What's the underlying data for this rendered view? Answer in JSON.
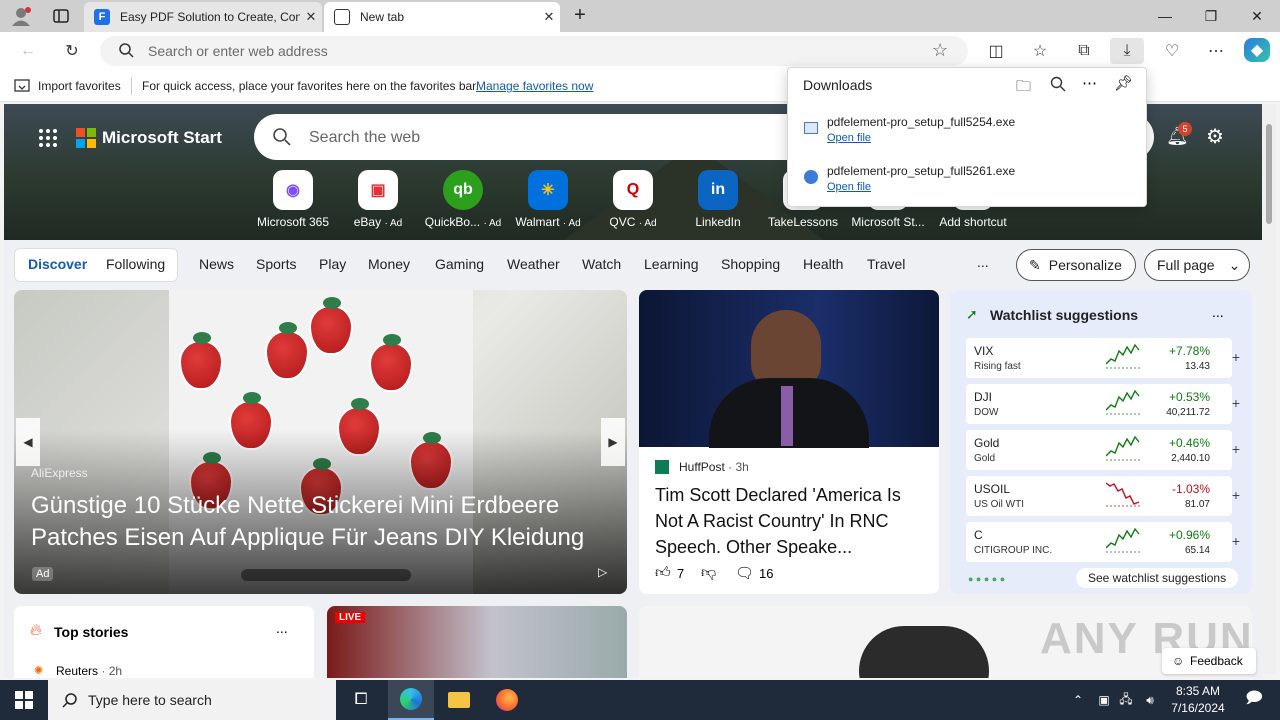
{
  "browser": {
    "tabs": [
      {
        "title": "Easy PDF Solution to Create, Con",
        "icon": "pdfelement-icon"
      },
      {
        "title": "New tab",
        "icon": "newtab-icon"
      }
    ],
    "address": {
      "placeholder": "Search or enter web address"
    },
    "window_controls": [
      "minimize",
      "restore",
      "close"
    ]
  },
  "favorites_bar": {
    "import_label": "Import favorites",
    "message": "For quick access, place your favorites here on the favorites bar.",
    "manage_link": "Manage favorites now"
  },
  "downloads": {
    "title": "Downloads",
    "items": [
      {
        "filename": "pdfelement-pro_setup_full5254.exe",
        "action": "Open file"
      },
      {
        "filename": "pdfelement-pro_setup_full5261.exe",
        "action": "Open file"
      }
    ]
  },
  "start": {
    "brand": "Microsoft Start",
    "search_placeholder": "Search the web",
    "notification_count": "5",
    "shortcuts": [
      {
        "label": "Microsoft 365",
        "ad": ""
      },
      {
        "label": "eBay",
        "ad": "· Ad"
      },
      {
        "label": "QuickBo...",
        "ad": "· Ad"
      },
      {
        "label": "Walmart",
        "ad": "· Ad"
      },
      {
        "label": "QVC",
        "ad": "· Ad"
      },
      {
        "label": "LinkedIn",
        "ad": ""
      },
      {
        "label": "TakeLessons",
        "ad": ""
      },
      {
        "label": "Microsoft St...",
        "ad": ""
      },
      {
        "label": "Add shortcut",
        "ad": ""
      }
    ],
    "nav": {
      "discover": "Discover",
      "following": "Following",
      "items": [
        "News",
        "Sports",
        "Play",
        "Money",
        "Gaming",
        "Weather",
        "Watch",
        "Learning",
        "Shopping",
        "Health",
        "Travel"
      ],
      "more": "...",
      "personalize": "Personalize",
      "layout": "Full page"
    }
  },
  "hero_card": {
    "source": "AliExpress",
    "headline": "Günstige 10 Stücke Nette Stickerei Mini Erdbeere Patches Eisen Auf Applique Für Jeans DIY Kleidung",
    "ad_badge": "Ad"
  },
  "news_card": {
    "source": "HuffPost",
    "age": "· 3h",
    "headline": "Tim Scott Declared 'America Is Not A Racist Country' In RNC Speech. Other Speake...",
    "likes": "7",
    "comments": "16"
  },
  "watchlist": {
    "title": "Watchlist suggestions",
    "more": "...",
    "rows": [
      {
        "symbol": "VIX",
        "sub": "Rising fast",
        "change": "+7.78%",
        "price": "13.43",
        "direction": "up"
      },
      {
        "symbol": "DJI",
        "sub": "DOW",
        "change": "+0.53%",
        "price": "40,211.72",
        "direction": "up"
      },
      {
        "symbol": "Gold",
        "sub": "Gold",
        "change": "+0.46%",
        "price": "2,440.10",
        "direction": "up"
      },
      {
        "symbol": "USOIL",
        "sub": "US Oil WTI",
        "change": "-1.03%",
        "price": "81.07",
        "direction": "down"
      },
      {
        "symbol": "C",
        "sub": "CITIGROUP INC.",
        "change": "+0.96%",
        "price": "65.14",
        "direction": "up"
      }
    ],
    "see_more": "See watchlist suggestions",
    "colors": {
      "up": "#107c10",
      "down": "#c50f1f"
    }
  },
  "top_stories": {
    "title": "Top stories",
    "more": "...",
    "first_source": "Reuters",
    "first_age": "· 2h"
  },
  "live_badge": "LIVE",
  "feedback": "Feedback",
  "watermark": "ANY RUN",
  "taskbar": {
    "search_placeholder": "Type here to search",
    "time": "8:35 AM",
    "date": "7/16/2024"
  }
}
